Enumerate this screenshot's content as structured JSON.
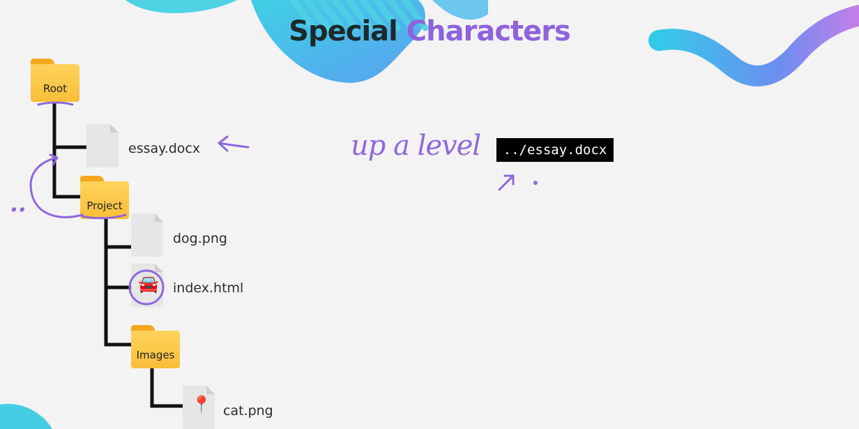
{
  "title": {
    "word1": "Special",
    "word2": "Characters"
  },
  "colors": {
    "title_dark": "#1b2a2b",
    "title_accent": "#8e63dd",
    "folder": "#f8be39",
    "annotation": "#8f67dd"
  },
  "tree": {
    "root_label": "Root",
    "essay_name": "essay.docx",
    "project_label": "Project",
    "dog_name": "dog.png",
    "index_name": "index.html",
    "images_label": "Images",
    "cat_name": "cat.png",
    "index_icon": "car-emoji",
    "cat_icon": "pin-emoji"
  },
  "command": {
    "text": "../essay.docx"
  },
  "annotations": {
    "up_level": "up a level",
    "dots": ".."
  }
}
